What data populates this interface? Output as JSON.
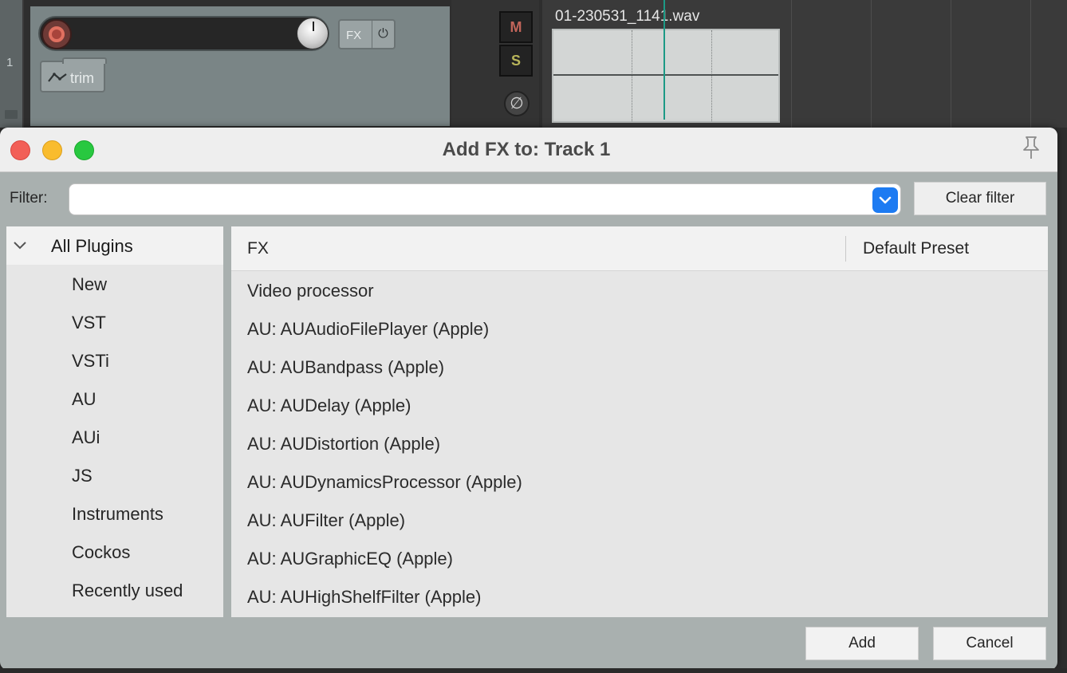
{
  "daw": {
    "track_number": "1",
    "fx_label": "FX",
    "power_glyph": "⏻",
    "trim_label": "trim",
    "mute_label": "M",
    "solo_label": "S",
    "phase_glyph": "∅",
    "clip_title": "01-230531_1141.wav",
    "colors": {
      "playhead": "#1c9a86",
      "mute": "#c2655a",
      "solo": "#b9b55a",
      "rec": "#e07060"
    }
  },
  "dialog": {
    "title": "Add FX to: Track 1",
    "filter_label": "Filter:",
    "filter_value": "",
    "clear_filter_label": "Clear filter",
    "tree": {
      "root_label": "All Plugins",
      "items": [
        "New",
        "VST",
        "VSTi",
        "AU",
        "AUi",
        "JS",
        "Instruments",
        "Cockos",
        "Recently used"
      ]
    },
    "list": {
      "columns": [
        "FX",
        "Default Preset"
      ],
      "rows": [
        "Video processor",
        "AU: AUAudioFilePlayer (Apple)",
        "AU: AUBandpass (Apple)",
        "AU: AUDelay (Apple)",
        "AU: AUDistortion (Apple)",
        "AU: AUDynamicsProcessor (Apple)",
        "AU: AUFilter (Apple)",
        "AU: AUGraphicEQ (Apple)",
        "AU: AUHighShelfFilter (Apple)"
      ]
    },
    "add_label": "Add",
    "cancel_label": "Cancel",
    "icons": [
      "close-icon",
      "minimize-icon",
      "maximize-icon",
      "pin-icon",
      "chevron-down-icon"
    ],
    "colors": {
      "accent": "#1d7bf2",
      "close": "#f25f57",
      "minimize": "#f9bc2e",
      "maximize": "#28c840"
    }
  }
}
